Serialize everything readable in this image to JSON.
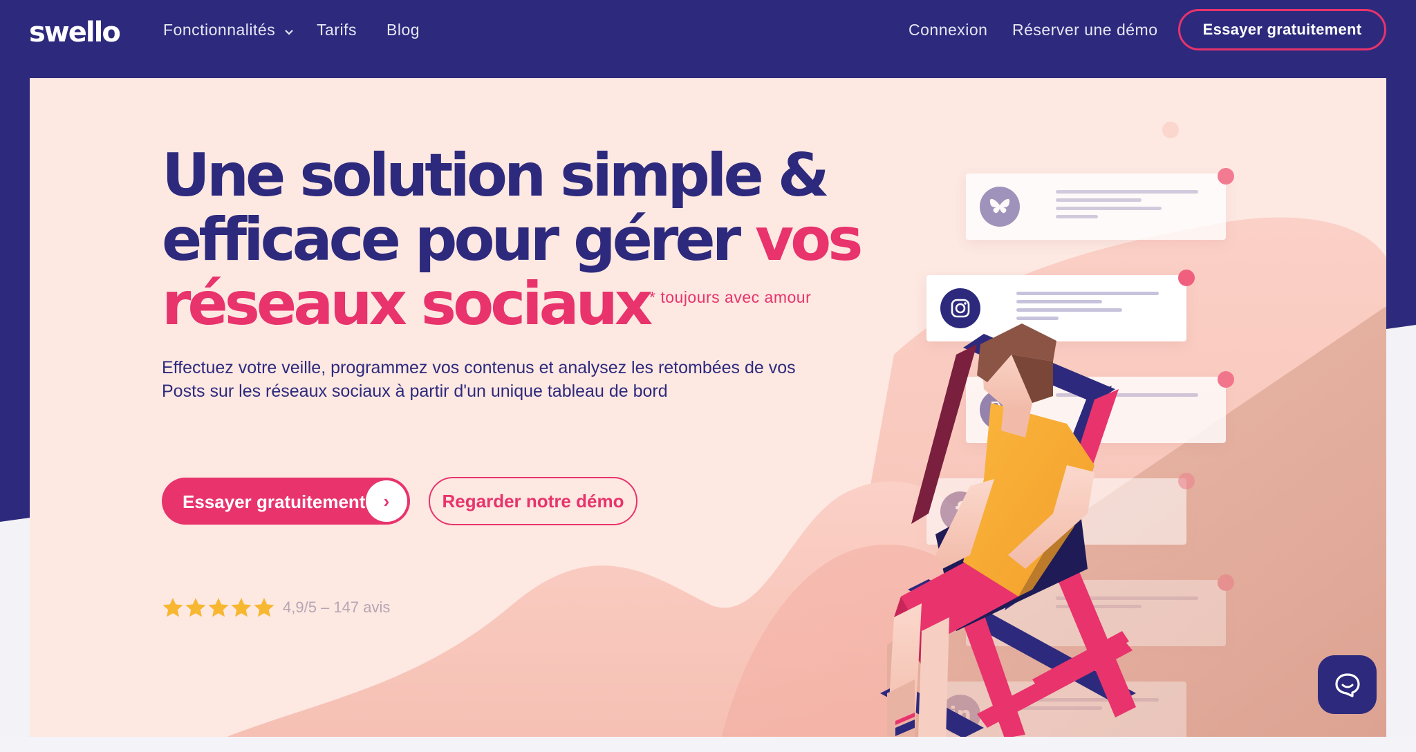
{
  "nav": {
    "logo": "swello",
    "links": [
      {
        "label": "Fonctionnalités"
      },
      {
        "label": "Tarifs"
      },
      {
        "label": "Blog"
      }
    ],
    "login": "Connexion",
    "demo": "Réserver une démo",
    "cta": "Essayer gratuitement"
  },
  "hero": {
    "headline_line1": "Une solution simple &",
    "headline_line2_a": "efficace pour gérer ",
    "headline_line2_b": "vos",
    "headline_line3": "réseaux sociaux",
    "footnote": "* toujours avec amour",
    "subtitle": "Effectuez votre veille, programmez vos contenus et analysez les retombées de vos Posts sur les réseaux sociaux à partir d'un unique tableau de bord",
    "primary_button": "Essayer gratuitement",
    "primary_arrow": "›",
    "secondary_button": "Regarder notre démo",
    "rating_stars": 5,
    "rating_text": "4,9/5 – 147 avis"
  },
  "cards": [
    {
      "network": "bluesky-icon"
    },
    {
      "network": "instagram-icon"
    },
    {
      "network": "x-icon"
    },
    {
      "network": "facebook-icon"
    },
    {
      "network": "linkedin-icon"
    }
  ],
  "colors": {
    "brand_navy": "#2d2a7d",
    "brand_pink": "#e8336c",
    "hero_bg": "#fde8e2",
    "star": "#f7b731"
  }
}
